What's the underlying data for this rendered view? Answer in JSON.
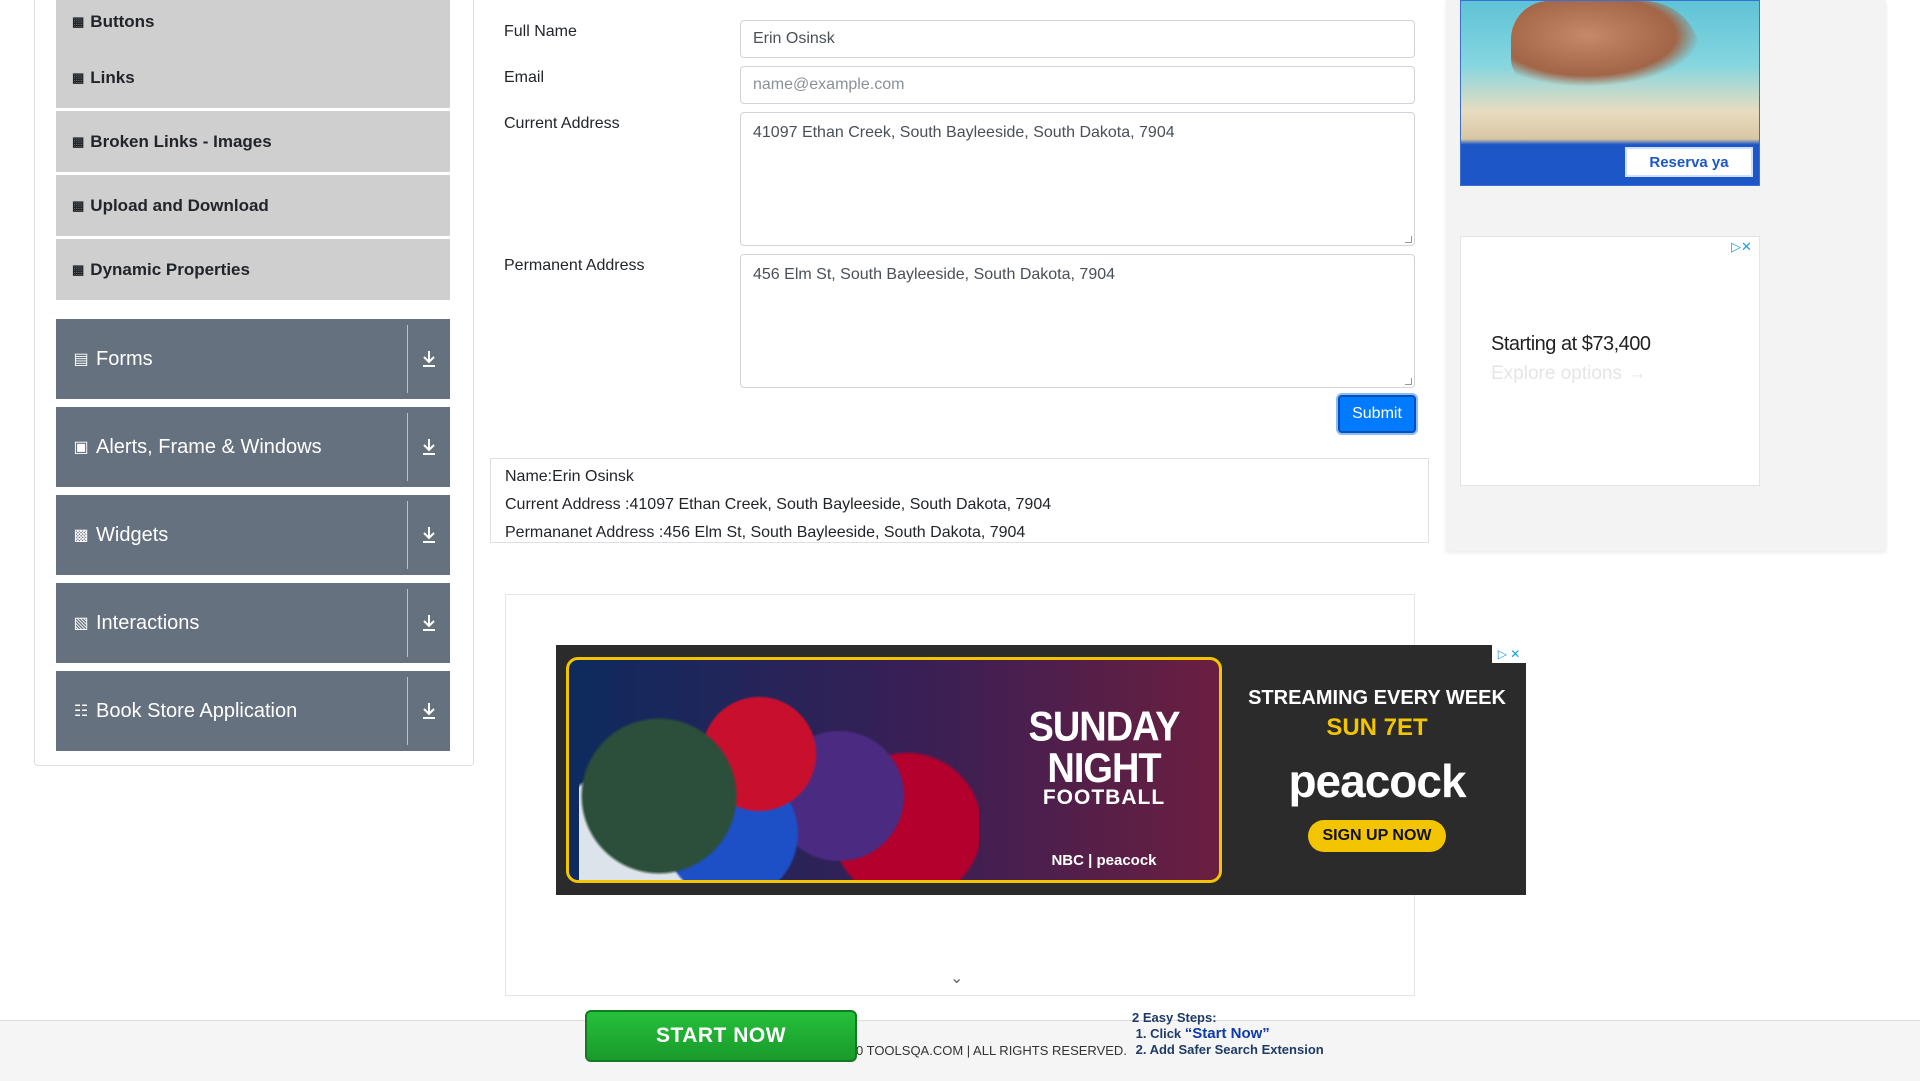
{
  "sidebar": {
    "sub_items": [
      {
        "label": "Buttons"
      },
      {
        "label": "Links"
      },
      {
        "label": "Broken Links - Images"
      },
      {
        "label": "Upload and Download"
      },
      {
        "label": "Dynamic Properties"
      }
    ],
    "groups": [
      {
        "label": "Forms",
        "icon": "form-icon"
      },
      {
        "label": "Alerts, Frame & Windows",
        "icon": "window-icon"
      },
      {
        "label": "Widgets",
        "icon": "widgets-icon"
      },
      {
        "label": "Interactions",
        "icon": "interactions-icon"
      },
      {
        "label": "Book Store Application",
        "icon": "books-icon"
      }
    ]
  },
  "form": {
    "full_name_label": "Full Name",
    "full_name_value": "Erin Osinsk",
    "email_label": "Email",
    "email_placeholder": "name@example.com",
    "current_address_label": "Current Address",
    "current_address_value": "41097 Ethan Creek, South Bayleeside, South Dakota, 7904",
    "permanent_address_label": "Permanent Address",
    "permanent_address_value": "456 Elm St, South Bayleeside, South Dakota, 7904",
    "submit_label": "Submit"
  },
  "output": {
    "name": "Name:Erin Osinsk",
    "current": "Current Address :41097 Ethan Creek, South Bayleeside, South Dakota, 7904",
    "permanent": "Permananet Address :456 Elm St, South Bayleeside, South Dakota, 7904"
  },
  "ads": {
    "beach_button": "Reserva ya",
    "car_price": "Starting at $73,400",
    "car_explore": "Explore options",
    "nfl_title_1": "SUNDAY NIGHT",
    "nfl_title_2": "FOOTBALL",
    "nfl_networks": "NBC | peacock",
    "nfl_streaming": "STREAMING EVERY WEEK",
    "nfl_time": "SUN 7ET",
    "nfl_brand": "peacock",
    "nfl_cta": "SIGN UP NOW"
  },
  "footer": {
    "copyright": "0 TOOLSQA.COM | ALL RIGHTS RESERVED.",
    "start_now": "START NOW",
    "steps_title": "2 Easy Steps:",
    "step1_prefix": "1. Click ",
    "step1_highlight": "“Start Now”",
    "step2": "2. Add Safer Search Extension"
  },
  "colors": {
    "group_bg": "#66717f",
    "sub_bg": "#cfcfcf",
    "primary": "#007bff",
    "start_green": "#1a9a2b"
  }
}
